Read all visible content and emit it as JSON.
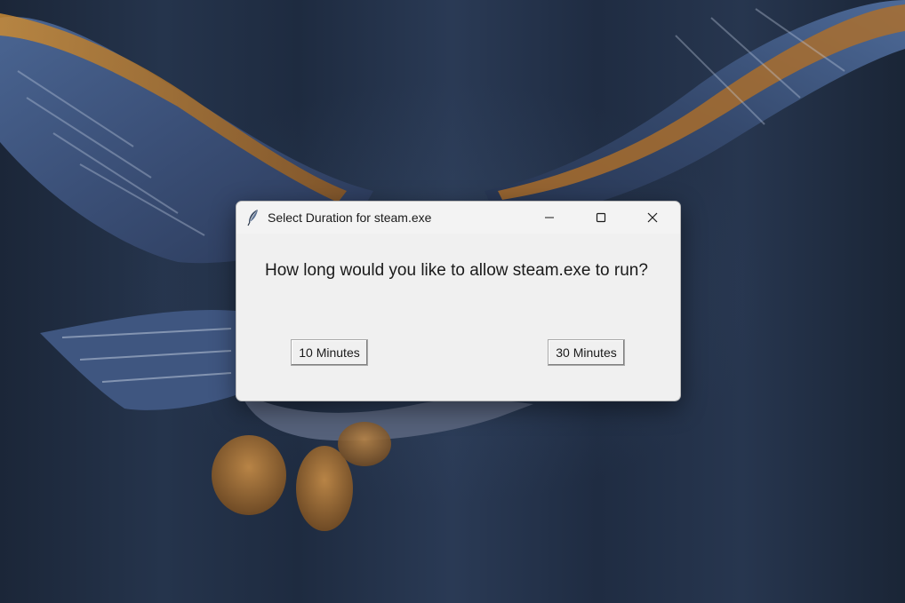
{
  "dialog": {
    "title": "Select Duration for steam.exe",
    "prompt": "How long would you like to allow steam.exe to run?",
    "buttons": [
      {
        "label": "10 Minutes"
      },
      {
        "label": "30 Minutes"
      }
    ],
    "icons": {
      "app": "feather-icon",
      "minimize": "minimize-icon",
      "maximize": "maximize-icon",
      "close": "close-icon"
    }
  },
  "wallpaper": {
    "subject": "owl in flight",
    "colors": {
      "background": "#1d2a3d",
      "wing_blue": "#3a4f78",
      "wing_gold": "#b8762c"
    }
  }
}
